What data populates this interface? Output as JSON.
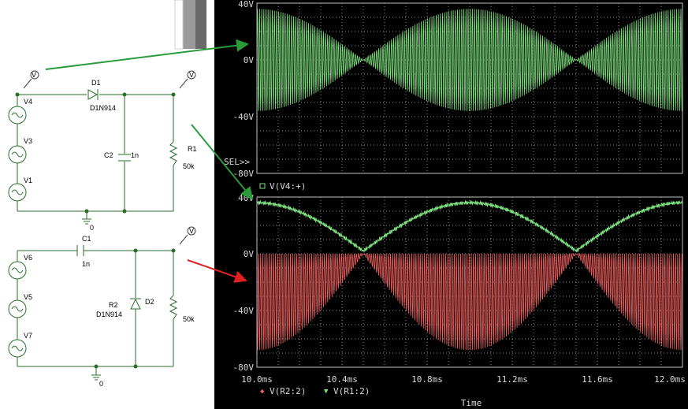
{
  "schematic": {
    "top": {
      "sources": [
        "V4",
        "V3",
        "V1"
      ],
      "diode_ref": "D1",
      "diode_model": "D1N914",
      "cap_ref": "C2",
      "cap_value": "1n",
      "res_ref": "R1",
      "res_value": "50k",
      "ground_label": "0",
      "probe_label": "V"
    },
    "bottom": {
      "sources": [
        "V6",
        "V5",
        "V7"
      ],
      "cap_ref": "C1",
      "cap_value": "1n",
      "diode_ref": "D2",
      "diode_label_ref": "R2",
      "diode_model": "D1N914",
      "res_value": "50k",
      "ground_label": "0",
      "probe_label": "V"
    },
    "arrow_colors": {
      "top": "#2a9a3a",
      "bottom": "#e02020"
    }
  },
  "scope": {
    "background": "#000000",
    "grid_color": "#8a8a8a",
    "text_color": "#d8d8d8",
    "sel_marker": "SEL>>",
    "time_label": "Time",
    "colors": {
      "v4": "#7ee07e",
      "r2": "#f06060",
      "r1": "#7ee07e"
    }
  },
  "chart_data": [
    {
      "type": "line",
      "title": "",
      "xlabel": "",
      "ylabel": "",
      "xlim": [
        10.0,
        12.0
      ],
      "ylim": [
        -80,
        40
      ],
      "yticks": [
        "40V",
        "0V",
        "-40V",
        "-80V"
      ],
      "series": [
        {
          "name": "V(V4:+)",
          "marker": "square",
          "description_envelope_peaks_ms": [
            10.0,
            11.0,
            12.0
          ],
          "envelope_nulls_ms": [
            10.5,
            11.5
          ],
          "peak_value": 36
        }
      ]
    },
    {
      "type": "line",
      "title": "",
      "xlabel": "Time",
      "ylabel": "",
      "xlim": [
        10.0,
        12.0
      ],
      "ylim": [
        -80,
        40
      ],
      "xticks": [
        "10.0ms",
        "10.4ms",
        "10.8ms",
        "11.2ms",
        "11.6ms",
        "12.0ms"
      ],
      "yticks": [
        "40V",
        "0V",
        "-40V",
        "-80V"
      ],
      "series": [
        {
          "name": "V(R2:2)",
          "marker": "diamond",
          "min_value": -68,
          "max_value": 0
        },
        {
          "name": "V(R1:2)",
          "marker": "triangle",
          "min_value": 0,
          "max_value": 34
        }
      ]
    }
  ]
}
